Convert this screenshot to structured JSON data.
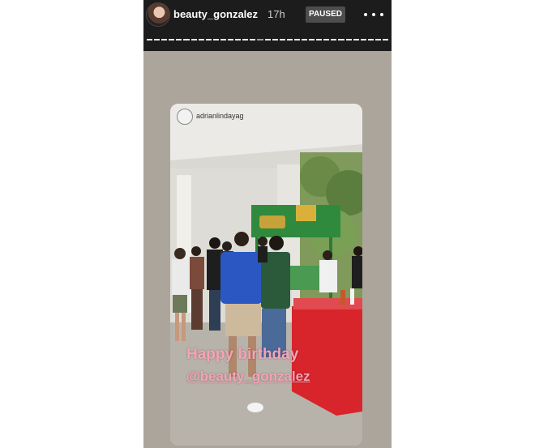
{
  "story": {
    "username": "beauty_gonzalez",
    "time": "17h",
    "status": "PAUSED",
    "progress_segments": 33,
    "active_segment": 15
  },
  "card": {
    "username": "adrianlindayag",
    "caption_line1": "Happy birthday",
    "caption_line2": "@beauty_gonzalez"
  }
}
